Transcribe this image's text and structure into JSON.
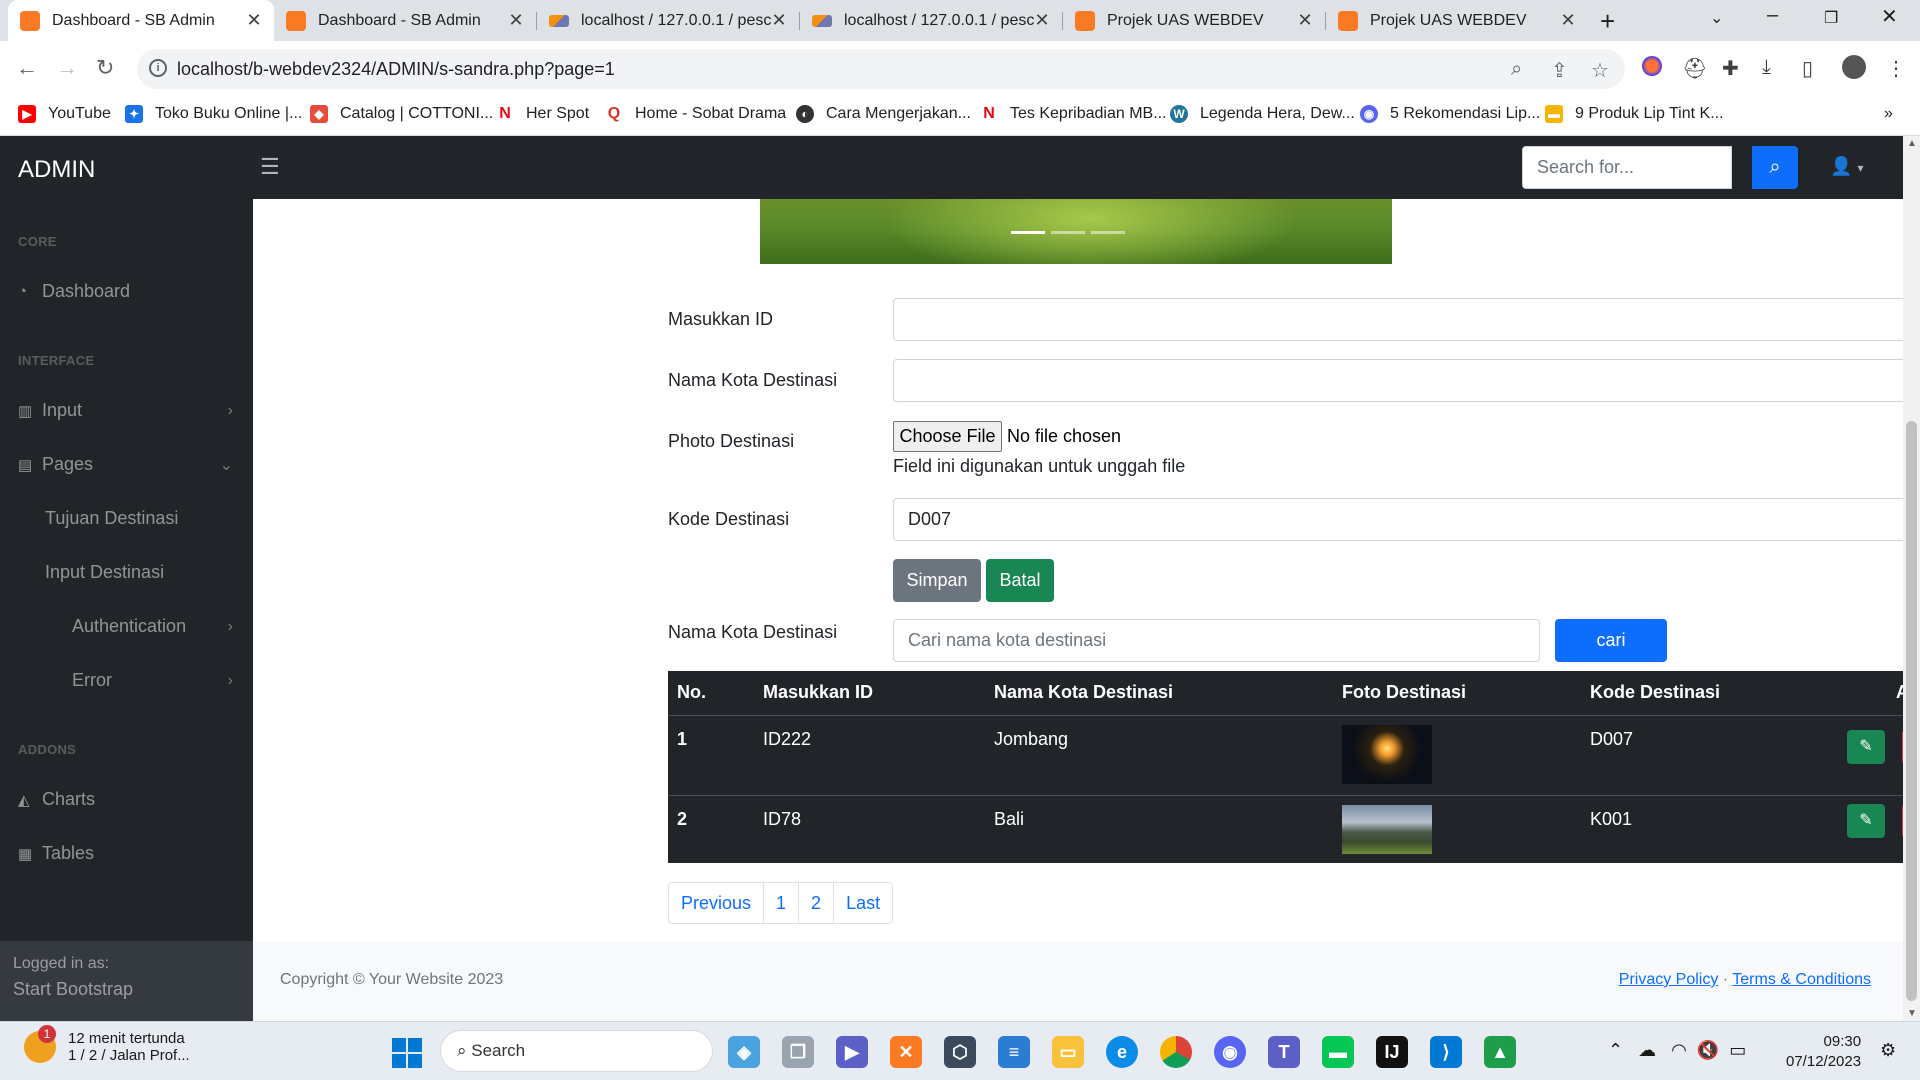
{
  "browser": {
    "tabs": [
      {
        "title": "Dashboard - SB Admin",
        "active": true
      },
      {
        "title": "Dashboard - SB Admin",
        "active": false
      },
      {
        "title": "localhost / 127.0.0.1 / pesc",
        "active": false
      },
      {
        "title": "localhost / 127.0.0.1 / pesc",
        "active": false
      },
      {
        "title": "Projek UAS WEBDEV",
        "active": false
      },
      {
        "title": "Projek UAS WEBDEV",
        "active": false
      }
    ],
    "url": "localhost/b-webdev2324/ADMIN/s-sandra.php?page=1",
    "bookmarks": [
      {
        "label": "YouTube",
        "color": "#ff0000",
        "icon": "youtube-icon"
      },
      {
        "label": "Toko Buku Online |...",
        "color": "#1a73e8",
        "icon": "book-icon"
      },
      {
        "label": "Catalog | COTTONI...",
        "color": "#e74c3c",
        "icon": "catalog-icon"
      },
      {
        "label": "Her Spot",
        "color": "#e50914",
        "icon": "netflix-icon"
      },
      {
        "label": "Home - Sobat Drama",
        "color": "#d93025",
        "icon": "drama-icon"
      },
      {
        "label": "Cara Mengerjakan...",
        "color": "#333333",
        "icon": "globe-icon"
      },
      {
        "label": "Tes Kepribadian MB...",
        "color": "#e50914",
        "icon": "netflix-icon"
      },
      {
        "label": "Legenda Hera, Dew...",
        "color": "#21759b",
        "icon": "wordpress-icon"
      },
      {
        "label": "5 Rekomendasi Lip...",
        "color": "#5865f2",
        "icon": "discord-icon"
      },
      {
        "label": "9 Produk Lip Tint K...",
        "color": "#f4b400",
        "icon": "bookmark-icon"
      }
    ],
    "bookmarks_overflow": "»"
  },
  "topnav": {
    "brand": "ADMIN",
    "search_placeholder": "Search for..."
  },
  "sidenav": {
    "headings": {
      "core": "CORE",
      "interface": "INTERFACE",
      "addons": "ADDONS"
    },
    "items": {
      "dashboard": "Dashboard",
      "input": "Input",
      "pages": "Pages",
      "tujuan": "Tujuan Destinasi",
      "input_destinasi": "Input Destinasi",
      "authentication": "Authentication",
      "error": "Error",
      "charts": "Charts",
      "tables": "Tables"
    },
    "footer": {
      "label": "Logged in as:",
      "user": "Start Bootstrap"
    }
  },
  "form": {
    "id_label": "Masukkan ID",
    "id_value": "",
    "nama_label": "Nama Kota Destinasi",
    "nama_value": "",
    "photo_label": "Photo Destinasi",
    "choose_file": "Choose File",
    "no_file": "No file chosen",
    "file_help": "Field ini digunakan untuk unggah file",
    "kode_label": "Kode Destinasi",
    "kode_value": "D007",
    "simpan": "Simpan",
    "batal": "Batal"
  },
  "search": {
    "label": "Nama Kota Destinasi",
    "placeholder": "Cari nama kota destinasi",
    "button": "cari"
  },
  "table": {
    "headers": [
      "No.",
      "Masukkan ID",
      "Nama Kota Destinasi",
      "Foto Destinasi",
      "Kode Destinasi",
      "Aksi"
    ],
    "rows": [
      {
        "no": "1",
        "id": "ID222",
        "nama": "Jombang",
        "photo": "sunset-sea",
        "kode": "D007"
      },
      {
        "no": "2",
        "id": "ID78",
        "nama": "Bali",
        "photo": "rocky-beach",
        "kode": "K001"
      }
    ]
  },
  "pagination": [
    "Previous",
    "1",
    "2",
    "Last"
  ],
  "footer": {
    "copyright": "Copyright © Your Website 2023",
    "privacy": "Privacy Policy",
    "separator": "·",
    "terms": "Terms & Conditions"
  },
  "taskbar": {
    "weather_line1": "12 menit tertunda",
    "weather_line2": "1 / 2 / Jalan Prof...",
    "notification_count": "1",
    "search_label": "Search",
    "time": "09:30",
    "date": "07/12/2023"
  },
  "colors": {
    "dark": "#212529",
    "primary": "#0d6efd",
    "success": "#198754",
    "danger": "#dc3545",
    "secondary": "#6c757d"
  }
}
